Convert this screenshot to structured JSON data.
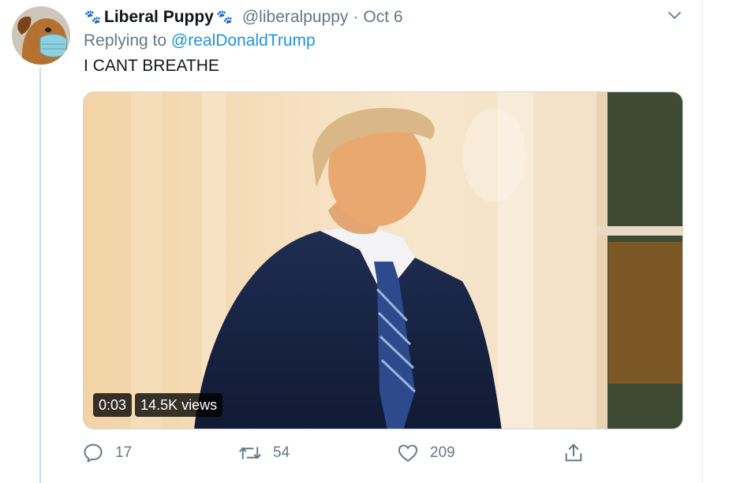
{
  "colors": {
    "link": "#1b95e0",
    "secondary_text": "#657786",
    "primary_text": "#14171a",
    "border": "#e6ecf0"
  },
  "tweet": {
    "avatar_icon": "dog-with-face-mask-avatar",
    "display_name": "Liberal Puppy",
    "name_emoji_left": "🐾",
    "name_emoji_right": "🐾",
    "handle": "@liberalpuppy",
    "separator": "·",
    "date": "Oct 6",
    "replying_prefix": "Replying to",
    "replying_to": "@realDonaldTrump",
    "text": "I CANT BREATHE",
    "media": {
      "type": "video",
      "duration": "0:03",
      "views": "14.5K views"
    },
    "actions": {
      "reply_count": "17",
      "retweet_count": "54",
      "like_count": "209",
      "share_icon": "share-icon"
    }
  }
}
